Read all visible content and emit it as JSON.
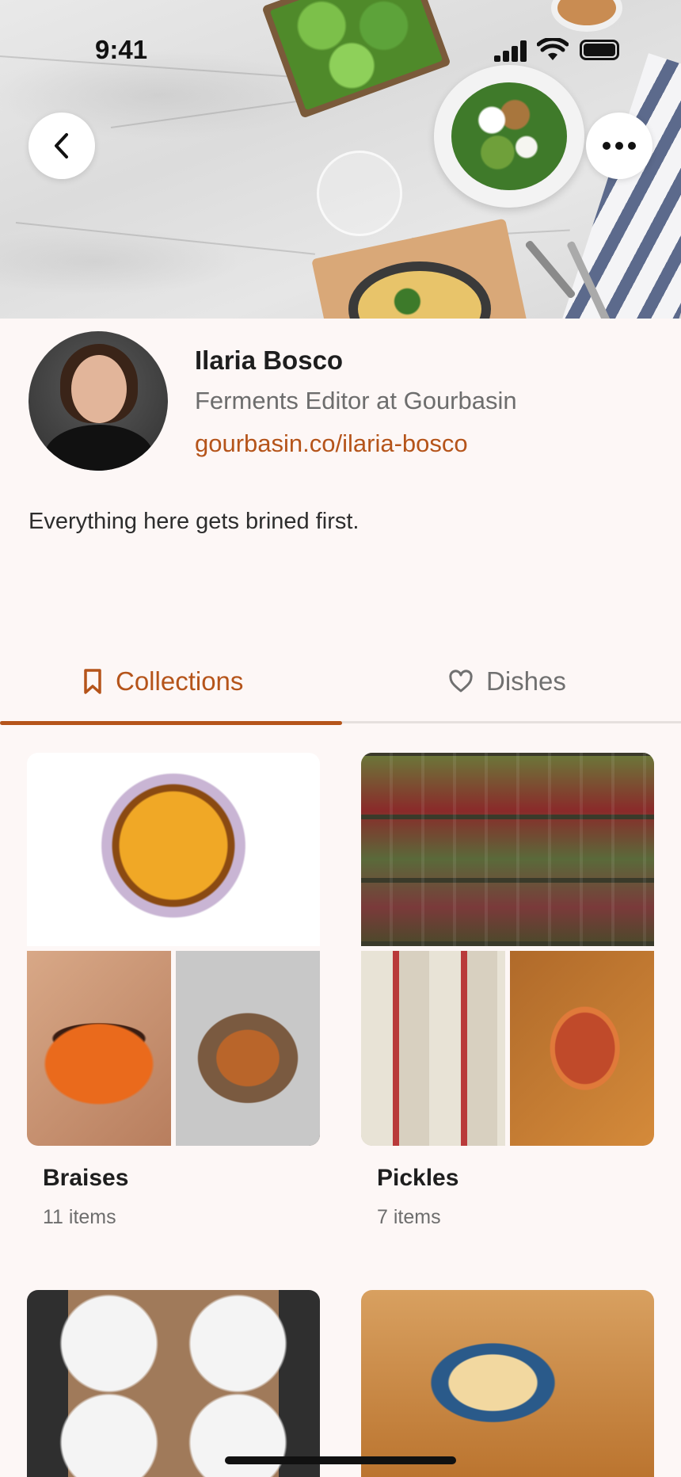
{
  "status_bar": {
    "time": "9:41"
  },
  "header": {
    "back_icon": "chevron-left-icon",
    "more_icon": "ellipsis-icon"
  },
  "profile": {
    "name": "Ilaria Bosco",
    "role": "Ferments Editor at Gourbasin",
    "link": "gourbasin.co/ilaria-bosco",
    "bio": "Everything here gets brined first."
  },
  "tabs": [
    {
      "label": "Collections",
      "icon": "bookmark-icon",
      "active": true
    },
    {
      "label": "Dishes",
      "icon": "heart-icon",
      "active": false
    }
  ],
  "collections": [
    {
      "title": "Braises",
      "count": "11 items"
    },
    {
      "title": "Pickles",
      "count": "7 items"
    }
  ],
  "colors": {
    "accent": "#b5541a",
    "background": "#fdf7f6",
    "muted": "#6d6d6d"
  }
}
